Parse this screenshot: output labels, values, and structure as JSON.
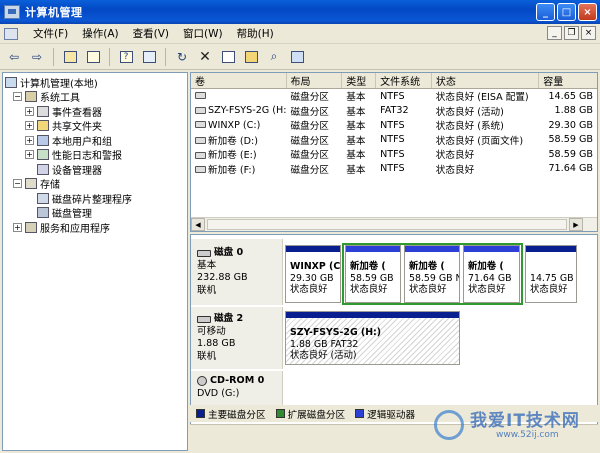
{
  "window": {
    "title": "计算机管理"
  },
  "menu": [
    "文件(F)",
    "操作(A)",
    "查看(V)",
    "窗口(W)",
    "帮助(H)"
  ],
  "mdi": {
    "min": "_",
    "restore": "❐",
    "close": "×"
  },
  "tree": [
    {
      "label": "计算机管理(本地)",
      "level": 0,
      "exp": ""
    },
    {
      "label": "系统工具",
      "level": 1,
      "exp": "−"
    },
    {
      "label": "事件查看器",
      "level": 2,
      "exp": "+"
    },
    {
      "label": "共享文件夹",
      "level": 2,
      "exp": "+"
    },
    {
      "label": "本地用户和组",
      "level": 2,
      "exp": "+"
    },
    {
      "label": "性能日志和警报",
      "level": 2,
      "exp": "+"
    },
    {
      "label": "设备管理器",
      "level": 2,
      "exp": ""
    },
    {
      "label": "存储",
      "level": 1,
      "exp": "−"
    },
    {
      "label": "磁盘碎片整理程序",
      "level": 2,
      "exp": ""
    },
    {
      "label": "磁盘管理",
      "level": 2,
      "exp": ""
    },
    {
      "label": "服务和应用程序",
      "level": 1,
      "exp": "+"
    }
  ],
  "volumes": {
    "headers": [
      "卷",
      "布局",
      "类型",
      "文件系统",
      "状态",
      "容量"
    ],
    "rows": [
      {
        "name": "",
        "layout": "磁盘分区",
        "type": "基本",
        "fs": "NTFS",
        "status": "状态良好 (EISA 配置)",
        "size": "14.65 GB"
      },
      {
        "name": "SZY-FSYS-2G (H:)",
        "layout": "磁盘分区",
        "type": "基本",
        "fs": "FAT32",
        "status": "状态良好 (活动)",
        "size": "1.88 GB"
      },
      {
        "name": "WINXP (C:)",
        "layout": "磁盘分区",
        "type": "基本",
        "fs": "NTFS",
        "status": "状态良好 (系统)",
        "size": "29.30 GB"
      },
      {
        "name": "新加卷 (D:)",
        "layout": "磁盘分区",
        "type": "基本",
        "fs": "NTFS",
        "status": "状态良好 (页面文件)",
        "size": "58.59 GB"
      },
      {
        "name": "新加卷 (E:)",
        "layout": "磁盘分区",
        "type": "基本",
        "fs": "NTFS",
        "status": "状态良好",
        "size": "58.59 GB"
      },
      {
        "name": "新加卷 (F:)",
        "layout": "磁盘分区",
        "type": "基本",
        "fs": "NTFS",
        "status": "状态良好",
        "size": "71.64 GB"
      }
    ]
  },
  "disks": {
    "disk0": {
      "name": "磁盘 0",
      "type": "基本",
      "size": "232.88 GB",
      "state": "联机",
      "parts": [
        {
          "name": "WINXP (C:)",
          "size": "29.30 GB",
          "status": "状态良好"
        },
        {
          "name": "新加卷 (",
          "size": "58.59 GB",
          "status": "状态良好"
        },
        {
          "name": "新加卷 (",
          "size": "58.59 GB N",
          "status": "状态良好"
        },
        {
          "name": "新加卷 (",
          "size": "71.64 GB",
          "status": "状态良好"
        },
        {
          "name": "",
          "size": "14.75 GB",
          "status": "状态良好"
        }
      ]
    },
    "disk2": {
      "name": "磁盘 2",
      "type": "可移动",
      "size": "1.88 GB",
      "state": "联机",
      "part": {
        "name": "SZY-FSYS-2G (H:)",
        "size": "1.88 GB FAT32",
        "status": "状态良好 (活动)"
      }
    },
    "cdrom": {
      "name": "CD-ROM 0",
      "type": "DVD (G:)"
    }
  },
  "legend": [
    {
      "label": "主要磁盘分区",
      "color": "#0a1f8f"
    },
    {
      "label": "扩展磁盘分区",
      "color": "#2e8b2e"
    },
    {
      "label": "逻辑驱动器",
      "color": "#2c3fd6"
    }
  ],
  "watermark": {
    "line1": "我爱IT技术网",
    "line2": "www.52ij.com"
  },
  "colors": {
    "primary": "#0a1f8f",
    "logical": "#2c3fd6",
    "extended": "#2f9a2f"
  }
}
